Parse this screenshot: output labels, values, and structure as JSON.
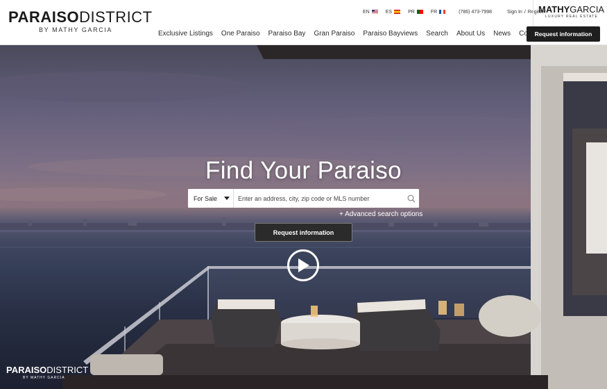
{
  "brand": {
    "logo_bold": "PARAISO",
    "logo_light": "DISTRICT",
    "logo_sub": "BY MATHY GARCIA"
  },
  "topbar": {
    "languages": [
      {
        "code": "EN",
        "flag": "us-flag-icon"
      },
      {
        "code": "ES",
        "flag": "es-flag-icon"
      },
      {
        "code": "PR",
        "flag": "pt-flag-icon"
      },
      {
        "code": "FR",
        "flag": "fr-flag-icon"
      }
    ],
    "phone": "(786) 473-7998",
    "sign_in": "Sign In",
    "separator": "/",
    "register": "Register"
  },
  "partner": {
    "name_bold": "MATHY",
    "name_light": "GARCIA",
    "tagline": "LUXURY REAL ESTATE"
  },
  "nav": {
    "items": [
      "Exclusive Listings",
      "One Paraiso",
      "Paraiso Bay",
      "Gran Paraiso",
      "Paraiso Bayviews",
      "Search",
      "About Us",
      "News",
      "Contact Us"
    ]
  },
  "header_cta": "Request information",
  "hero": {
    "title": "Find Your Paraiso",
    "search_type": "For Sale",
    "search_placeholder": "Enter an address, city, zip code or MLS number",
    "advanced_link": "+ Advanced search options",
    "cta": "Request information",
    "play_icon": "play-icon"
  },
  "footer_logo": {
    "bold": "PARAISO",
    "light": "DISTRICT",
    "sub": "BY MATHY GARCIA"
  },
  "colors": {
    "dark": "#1e1e1e",
    "white": "#ffffff",
    "sky_top": "#5b5872",
    "sky_horizon": "#8a7582",
    "water": "#333d55"
  }
}
